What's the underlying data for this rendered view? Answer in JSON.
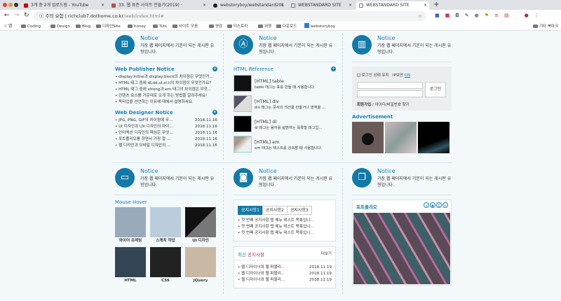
{
  "browser": {
    "tabs": [
      {
        "label": "3개 중 2개 업로드됨 - YouTube"
      },
      {
        "label": "33. 웹 표준 사이트 만들기(2019) ·"
      },
      {
        "label": "webstoryboy/webstandard201"
      },
      {
        "label": "WEBSTANDARD SITE"
      },
      {
        "label": "WEBSTANDARD SITE"
      }
    ],
    "security": "주의 요함",
    "url_host": "richclub7.dothome.co.kr",
    "url_path": "/web/index.html#",
    "bookmarks": [
      "앱",
      "Coding",
      "Design",
      "Blog",
      "디자인Site",
      "honey",
      "Tuts",
      "사이트 모음",
      "영감",
      "티스토리",
      "위젯",
      "다운로드",
      "webstoryboy"
    ],
    "other_bookmarks": "기타 북마크"
  },
  "notice": {
    "title": "Notice",
    "desc": "가장 웹 페이지에서 기본이 되는 게시판 유형입니다."
  },
  "publisher": {
    "title": "Web Publisher Notice",
    "items": [
      "display:inline과 display:block의 차이점은 무엇인가…",
      "HTML 태그 중에 dl,dd,ul,ol,li의 차이점이 무엇인가요?",
      "HTML 태그 중에 strong과 em 태그의 차이점은 무엇…",
      "컨텐츠 요소를 가운데로 오게 하는 방법을 알려주세요!",
      "독타입을 선언하는 이유에 대해서 설명하세요."
    ]
  },
  "designer": {
    "title": "Web Designer Notice",
    "items": [
      {
        "t": "JPG, PNG, GIF의 차이점에 무…",
        "d": "2018.11.16"
      },
      {
        "t": "UI 디자인과 UX 디자인의 차이…",
        "d": "2018.11.16"
      },
      {
        "t": "인터렉션 디자인의 핵심은 무엇…",
        "d": "2018.11.16"
      },
      {
        "t": "포트폴리오를 하면서 가장 잘 …",
        "d": "2018.11.16"
      },
      {
        "t": "웹 디자인과 모바일 디자인의 …",
        "d": "2018.11.16"
      }
    ]
  },
  "reference": {
    "title": "HTML Reference",
    "items": [
      {
        "t": "[HTML] table",
        "s": "table 태그는 표를 만들 때 사용합니다."
      },
      {
        "t": "[HTML] div",
        "s": "div 태그는 문서의 섹션을 만들거나 영역을 …"
      },
      {
        "t": "[HTML] dl",
        "s": "dl 태그는 용어를 설명하는 목록형 태그입…"
      },
      {
        "t": "[HTML] em",
        "s": "em 태그는 텍스트를 강조할 때 사용합니다."
      }
    ]
  },
  "login": {
    "keep": "로그인 상태 유지",
    "ip": "IP보안",
    "ip_state": "ON",
    "button": "로그인",
    "join": "회원가입",
    "find": "아이디/비밀번호 찾기"
  },
  "ad": {
    "title": "Advertisement"
  },
  "hover": {
    "title": "Mouse Hover",
    "items": [
      "와이어 프레임",
      "스케치 작업",
      "UI 디자인",
      "HTML",
      "CSS",
      "jQuery"
    ]
  },
  "tabnotice": {
    "tabs": [
      "공지사항1",
      "공지사항2",
      "공지사항3"
    ],
    "items": [
      "첫 번째 공지사항 탭 메뉴 테스트 목록입니…",
      "첫 번째 공지사항 탭 메뉴 테스트 목록입니…",
      "첫 번째 공지사항 탭 메뉴 테스트 목록입니…"
    ]
  },
  "latest": {
    "title_a": "최신",
    "title_b": "공지사항",
    "more": "더보기",
    "items": [
      {
        "t": "웹 디자이너와 웹 퍼블리…",
        "d": "2018.11.19"
      },
      {
        "t": "웹 디자이너와 웹 퍼블리…",
        "d": "2018.11.19"
      },
      {
        "t": "웹 디자이너와 웹 퍼블리…",
        "d": "2018.11.19"
      }
    ]
  },
  "portfolio": {
    "title": "포트폴리오"
  }
}
